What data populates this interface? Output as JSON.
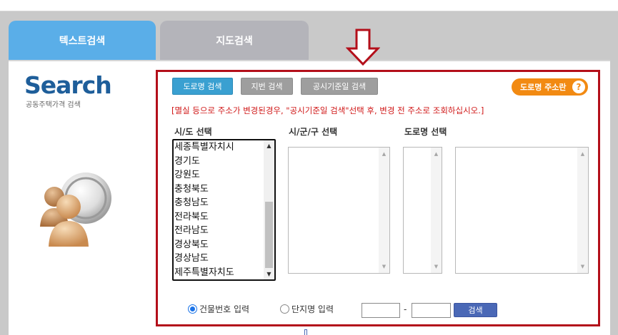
{
  "tabs": {
    "text_search": "텍스트검색",
    "map_search": "지도검색"
  },
  "logo": {
    "title": "Search",
    "subtitle": "공동주택가격 검색"
  },
  "search_modes": {
    "road": "도로명 검색",
    "lot": "지번 검색",
    "notice_date": "공시기준일 검색"
  },
  "guide_button": "도로명 주소란",
  "help_glyph": "?",
  "notice": "[멸실 등으로 주소가 변경된경우, \"공시기준일 검색\"선택 후, 변경 전 주소로 조회하십시오.]",
  "columns": {
    "sido": "시/도 선택",
    "sigungu": "시/군/구 선택",
    "road": "도로명 선택"
  },
  "sido_options": [
    "세종특별자치시",
    "경기도",
    "강원도",
    "충청북도",
    "충청남도",
    "전라북도",
    "전라남도",
    "경상북도",
    "경상남도",
    "제주특별자치도"
  ],
  "radios": {
    "building_number": "건물번호 입력",
    "complex_name": "단지명 입력"
  },
  "dash": "-",
  "search_button": "검색",
  "colors": {
    "accent_red": "#b30f1a",
    "tab_active": "#5aaee8",
    "tab_inactive": "#b4b4ba",
    "road_button": "#3aa0d1",
    "guide_orange": "#f28a12",
    "search_blue": "#4a68b6",
    "notice_red": "#d01818"
  },
  "icons": {
    "arrow": "down-arrow-icon",
    "help": "help-icon",
    "illustration": "user-globe-icon"
  }
}
